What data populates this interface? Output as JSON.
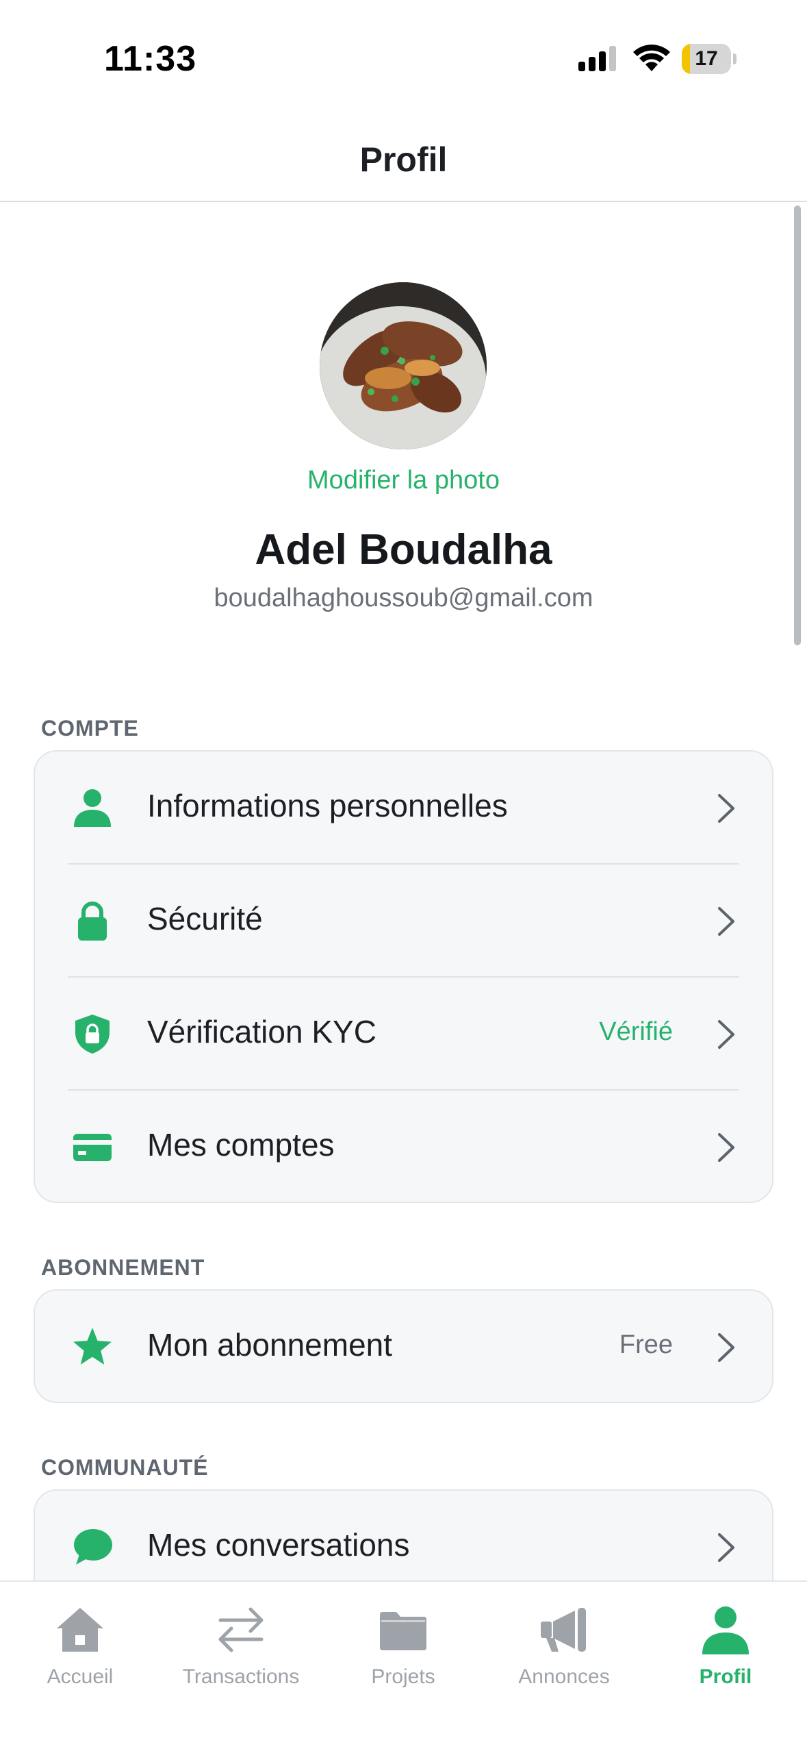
{
  "status_bar": {
    "time": "11:33",
    "battery": "17",
    "battery_level": 0.17
  },
  "header": {
    "title": "Profil"
  },
  "profile": {
    "change_photo_label": "Modifier la photo",
    "name": "Adel Boudalha",
    "email": "boudalhaghoussoub@gmail.com"
  },
  "sections": {
    "account": {
      "label": "COMPTE",
      "items": [
        {
          "label": "Informations personnelles",
          "icon": "person-icon",
          "value": ""
        },
        {
          "label": "Sécurité",
          "icon": "lock-icon",
          "value": ""
        },
        {
          "label": "Vérification KYC",
          "icon": "shield-lock-icon",
          "value": "Vérifié"
        },
        {
          "label": "Mes comptes",
          "icon": "card-icon",
          "value": ""
        }
      ]
    },
    "subscription": {
      "label": "ABONNEMENT",
      "items": [
        {
          "label": "Mon abonnement",
          "icon": "star-icon",
          "value": "Free"
        }
      ]
    },
    "community": {
      "label": "COMMUNAUTÉ",
      "items": [
        {
          "label": "Mes conversations",
          "icon": "chat-bubble-icon",
          "value": ""
        }
      ]
    }
  },
  "tab_bar": {
    "tabs": [
      {
        "label": "Accueil",
        "icon": "home-icon"
      },
      {
        "label": "Transactions",
        "icon": "arrows-icon"
      },
      {
        "label": "Projets",
        "icon": "folder-icon"
      },
      {
        "label": "Annonces",
        "icon": "megaphone-icon"
      },
      {
        "label": "Profil",
        "icon": "person-icon",
        "active": true
      }
    ]
  },
  "colors": {
    "accent": "#27b26c",
    "muted": "#9ea3a9",
    "text": "#1c1f24"
  }
}
